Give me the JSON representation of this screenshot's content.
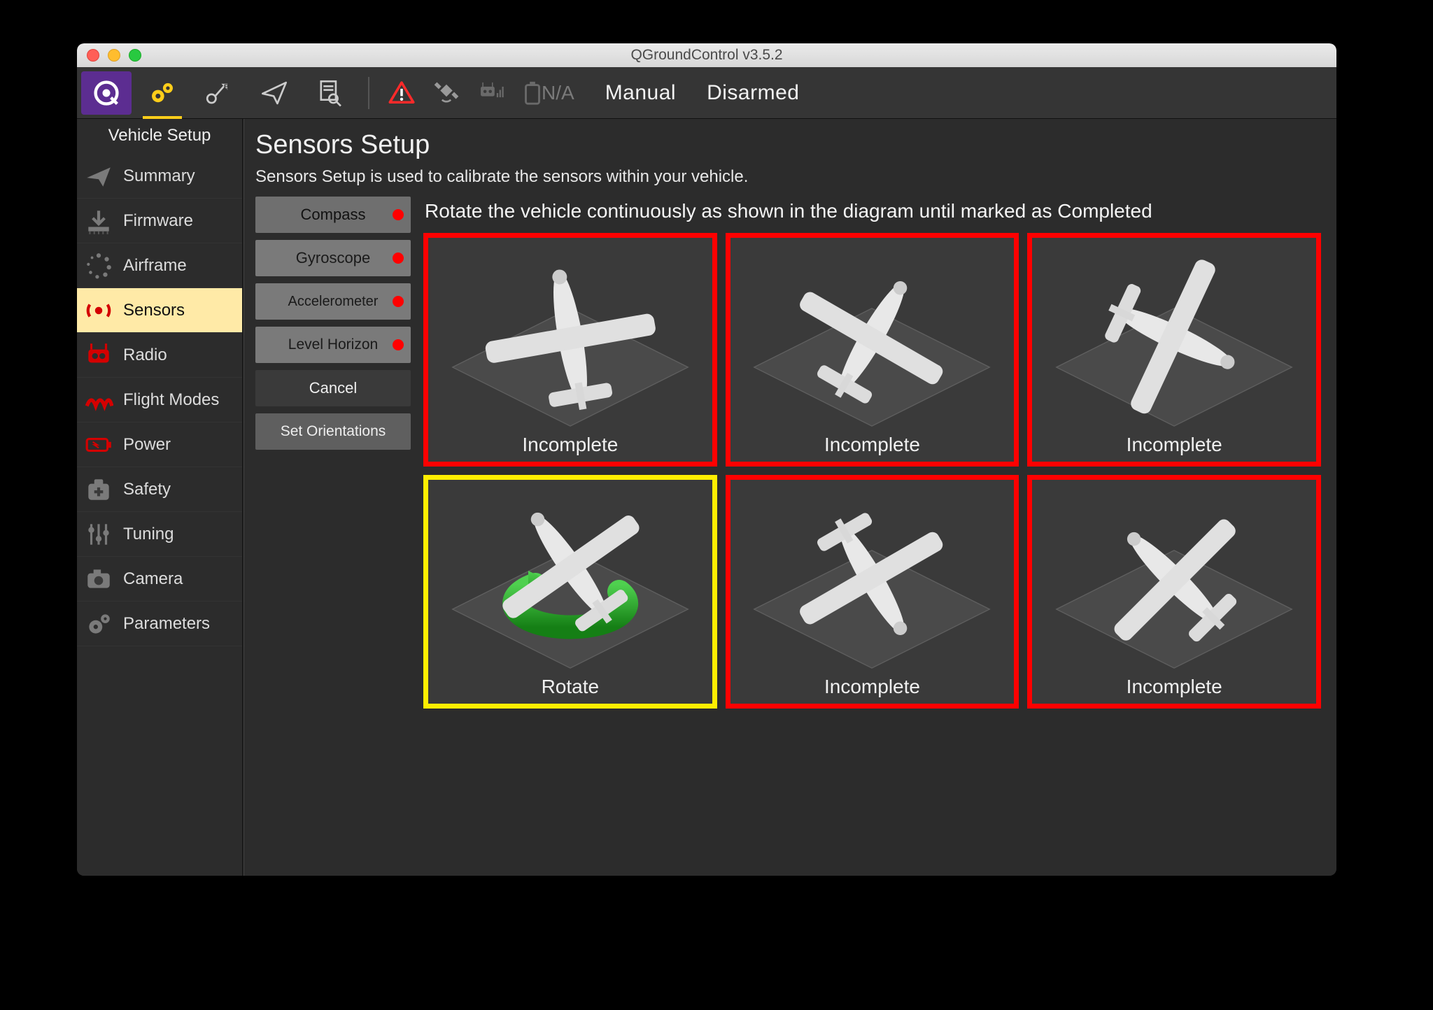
{
  "window": {
    "title": "QGroundControl v3.5.2"
  },
  "toolbar": {
    "battery_na": "N/A",
    "mode": "Manual",
    "arm_state": "Disarmed"
  },
  "sidebar": {
    "title": "Vehicle Setup",
    "items": [
      {
        "label": "Summary"
      },
      {
        "label": "Firmware"
      },
      {
        "label": "Airframe"
      },
      {
        "label": "Sensors"
      },
      {
        "label": "Radio"
      },
      {
        "label": "Flight Modes"
      },
      {
        "label": "Power"
      },
      {
        "label": "Safety"
      },
      {
        "label": "Tuning"
      },
      {
        "label": "Camera"
      },
      {
        "label": "Parameters"
      }
    ]
  },
  "page": {
    "title": "Sensors Setup",
    "description": "Sensors Setup is used to calibrate the sensors within your vehicle.",
    "instruction": "Rotate the vehicle continuously as shown in the diagram until marked as Completed"
  },
  "cal_buttons": {
    "compass": "Compass",
    "gyroscope": "Gyroscope",
    "accelerometer": "Accelerometer",
    "level_horizon": "Level Horizon",
    "cancel": "Cancel",
    "set_orientations": "Set Orientations"
  },
  "tiles": [
    {
      "caption": "Incomplete",
      "state": "incomplete"
    },
    {
      "caption": "Incomplete",
      "state": "incomplete"
    },
    {
      "caption": "Incomplete",
      "state": "incomplete"
    },
    {
      "caption": "Rotate",
      "state": "current"
    },
    {
      "caption": "Incomplete",
      "state": "incomplete"
    },
    {
      "caption": "Incomplete",
      "state": "incomplete"
    }
  ],
  "colors": {
    "accent_purple": "#5c2d91",
    "accent_yellow": "#ffce1a",
    "status_red": "#ff0000",
    "status_yellow": "#ffee00"
  }
}
